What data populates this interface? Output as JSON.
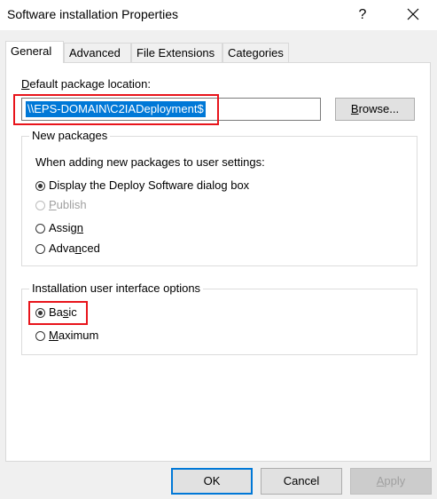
{
  "window": {
    "title": "Software installation Properties",
    "help_glyph": "?",
    "close_icon": "close-icon"
  },
  "tabs": [
    {
      "label": "General",
      "active": true
    },
    {
      "label": "Advanced",
      "active": false
    },
    {
      "label": "File Extensions",
      "active": false
    },
    {
      "label": "Categories",
      "active": false
    }
  ],
  "location": {
    "label_accel": "D",
    "label_rest": "efault package location:",
    "value": "\\\\EPS-DOMAIN\\C2IADeployment$",
    "browse_accel": "B",
    "browse_rest": "rowse..."
  },
  "new_packages": {
    "title": "New packages",
    "subtitle": "When adding new packages to user settings:",
    "options": [
      {
        "label": "Display the Deploy Software dialog box",
        "checked": true,
        "disabled": false
      },
      {
        "label_accel": "P",
        "label_rest": "ublish",
        "checked": false,
        "disabled": true
      },
      {
        "label_pre": "Assig",
        "label_accel": "n",
        "label_rest": "",
        "checked": false,
        "disabled": false
      },
      {
        "label_pre": "Adva",
        "label_accel": "n",
        "label_rest": "ced",
        "checked": false,
        "disabled": false
      }
    ]
  },
  "ui_options": {
    "title": "Installation user interface options",
    "options": [
      {
        "label_pre": "Ba",
        "label_accel": "s",
        "label_rest": "ic",
        "checked": true
      },
      {
        "label_accel": "M",
        "label_rest": "aximum",
        "checked": false
      }
    ]
  },
  "footer": {
    "ok": "OK",
    "cancel": "Cancel",
    "apply_accel": "A",
    "apply_rest": "pply"
  },
  "colors": {
    "selection": "#0078d7",
    "highlight_box": "#e8141b"
  }
}
